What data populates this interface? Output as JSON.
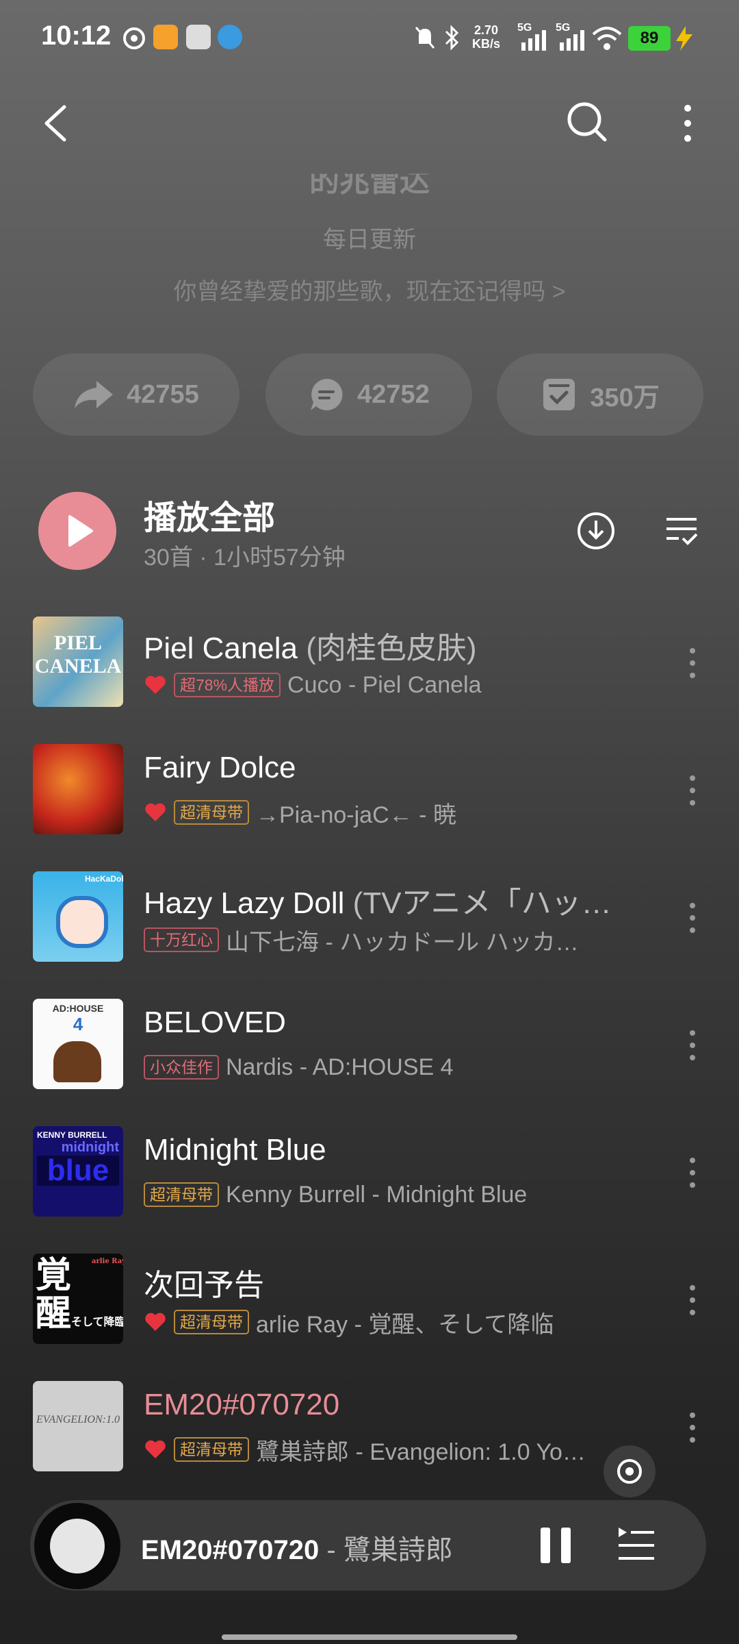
{
  "status_bar": {
    "time": "10:12",
    "net_speed_value": "2.70",
    "net_speed_unit": "KB/s",
    "signal_label_1": "5G",
    "signal_label_2": "5G",
    "battery": "89"
  },
  "header": {
    "title_partial": "的兆雷达",
    "subtitle": "每日更新",
    "description": "你曾经挚爱的那些歌，现在还记得吗 >"
  },
  "stats": {
    "shares": "42755",
    "comments": "42752",
    "collects": "350万"
  },
  "play_all": {
    "label": "播放全部",
    "meta": "30首 · 1小时57分钟"
  },
  "songs": [
    {
      "title": "Piel Canela",
      "alt_title": " (肉桂色皮肤)",
      "liked": true,
      "badge": "超78%人播放",
      "badge_style": "red",
      "artist": "Cuco - Piel Canela",
      "playing": false
    },
    {
      "title": "Fairy Dolce",
      "alt_title": "",
      "liked": true,
      "badge": "超清母带",
      "badge_style": "gold",
      "artist": "→Pia-no-jaC← - 暁",
      "playing": false
    },
    {
      "title": "Hazy Lazy Doll",
      "alt_title": " (TVアニメ「ハッ…",
      "liked": false,
      "badge": "十万红心",
      "badge_style": "red",
      "artist": "山下七海 - ハッカドール ハッカ…",
      "playing": false
    },
    {
      "title": "BELOVED",
      "alt_title": "",
      "liked": false,
      "badge": "小众佳作",
      "badge_style": "red",
      "artist": "Nardis - AD:HOUSE 4",
      "playing": false
    },
    {
      "title": "Midnight Blue",
      "alt_title": "",
      "liked": false,
      "badge": "超清母带",
      "badge_style": "gold",
      "artist": "Kenny Burrell - Midnight Blue",
      "playing": false
    },
    {
      "title": "次回予告",
      "alt_title": "",
      "liked": true,
      "badge": "超清母带",
      "badge_style": "gold",
      "artist": "arlie Ray - 覚醒、そして降临",
      "playing": false
    },
    {
      "title": "EM20#070720",
      "alt_title": "",
      "liked": true,
      "badge": "超清母带",
      "badge_style": "gold",
      "artist": "鷺巣詩郎 - Evangelion: 1.0 Yo…",
      "playing": true
    }
  ],
  "cover_texts": {
    "c1_a": "PIEL",
    "c1_b": "CANELA",
    "c3": "HacKaDoll",
    "c4_a": "AD:HOUSE",
    "c4_b": "4",
    "c5_a": "KENNY BURRELL",
    "c5_b": "midnight",
    "c5_c": "blue",
    "c6_a": "覚",
    "c6_b": "醒",
    "c6_c": "そして降臨",
    "c6_d": "arlie Ray",
    "c7": "EVANGELION:1.0"
  },
  "mini_player": {
    "title": "EM20#070720",
    "artist_sep": " - 鷺巣詩郎"
  },
  "colors": {
    "accent": "#e88d96",
    "playing_title": "#e88d96",
    "badge_red": "#e56b77",
    "badge_gold": "#e4a94a"
  }
}
